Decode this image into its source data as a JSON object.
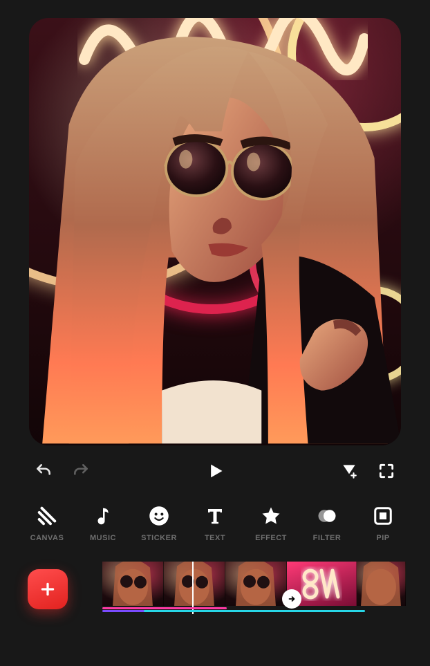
{
  "transport": {
    "undo": "undo",
    "redo": "redo",
    "play": "play",
    "add_marker": "add-marker",
    "fullscreen": "fullscreen"
  },
  "toolbar": [
    {
      "id": "canvas",
      "label": "CANVAS"
    },
    {
      "id": "music",
      "label": "MUSIC"
    },
    {
      "id": "sticker",
      "label": "STICKER"
    },
    {
      "id": "text",
      "label": "TEXT"
    },
    {
      "id": "effect",
      "label": "EFFECT"
    },
    {
      "id": "filter",
      "label": "FILTER"
    },
    {
      "id": "pip",
      "label": "PIP"
    }
  ],
  "timeline": {
    "add_label": "add-clip"
  }
}
